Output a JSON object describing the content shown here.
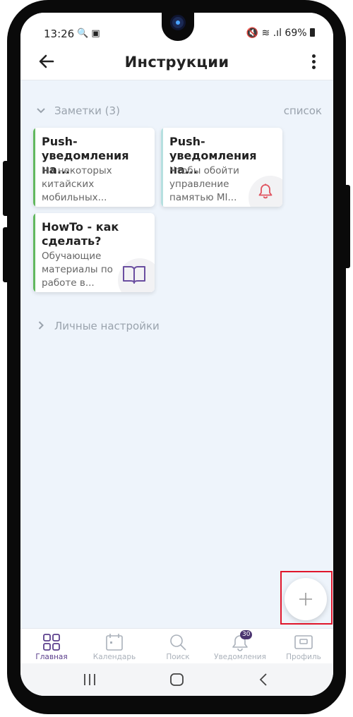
{
  "status_bar": {
    "time": "13:26",
    "icons_left": "🔍 ▣",
    "battery": "69%",
    "icons_right": "🔇 ≋ .ıl"
  },
  "app_bar": {
    "title": "Инструкции",
    "back_icon": "arrow-left-icon",
    "more_icon": "more-vert-icon"
  },
  "notes_section": {
    "header": "Заметки (3)",
    "view_toggle": "список",
    "cards": [
      {
        "title": "Push-\nуведомления на...",
        "text": "На некоторых\nкитайских\nмобильных...",
        "accent": "#62b85f",
        "icon": ""
      },
      {
        "title": "Push-\nуведомления на...",
        "text": "Чтобы обойти\nуправление\nпамятью MI...",
        "accent": "#b6e0e0",
        "icon": "bell-icon"
      },
      {
        "title": "HowTo - как\nсделать?",
        "text": "Обучающие\nматериалы по\nработе в...",
        "accent": "#62b85f",
        "icon": "book-icon"
      }
    ]
  },
  "personal_section": {
    "header": "Личные настройки"
  },
  "fab": {
    "icon": "plus-icon"
  },
  "bottom_nav": {
    "items": [
      {
        "label": "Главная",
        "icon": "grid-icon",
        "active": true
      },
      {
        "label": "Календарь",
        "icon": "calendar-icon",
        "active": false
      },
      {
        "label": "Поиск",
        "icon": "search-icon",
        "active": false
      },
      {
        "label": "Уведомления",
        "icon": "bell-icon",
        "badge": "30",
        "active": false
      },
      {
        "label": "Профиль",
        "icon": "profile-icon",
        "active": false
      }
    ]
  },
  "colors": {
    "accent": "#5b3e8c",
    "background": "#eef4fb",
    "highlight": "#e0162b",
    "bell": "#e0525e",
    "book": "#6a4ea0"
  }
}
